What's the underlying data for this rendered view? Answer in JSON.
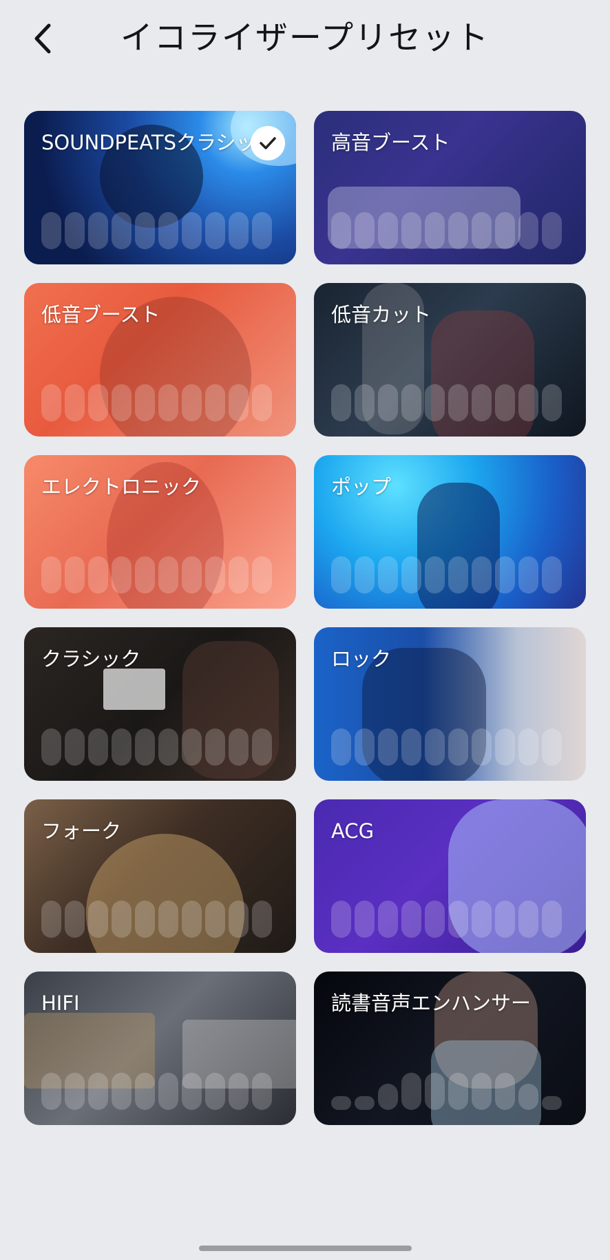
{
  "header": {
    "title": "イコライザープリセット",
    "back_icon": "chevron-left-icon"
  },
  "presets": [
    {
      "label": "SOUNDPEATSクラシック",
      "selected": true
    },
    {
      "label": "高音ブースト",
      "selected": false
    },
    {
      "label": "低音ブースト",
      "selected": false
    },
    {
      "label": "低音カット",
      "selected": false
    },
    {
      "label": "エレクトロニック",
      "selected": false
    },
    {
      "label": "ポップ",
      "selected": false
    },
    {
      "label": "クラシック",
      "selected": false
    },
    {
      "label": "ロック",
      "selected": false
    },
    {
      "label": "フォーク",
      "selected": false
    },
    {
      "label": "ACG",
      "selected": false
    },
    {
      "label": "HIFI",
      "selected": false
    },
    {
      "label": "読書音声エンハンサー",
      "selected": false
    }
  ],
  "colors": {
    "background": "#e9eaee",
    "selected_border": "#3aa6f2",
    "title_text": "#141414"
  }
}
